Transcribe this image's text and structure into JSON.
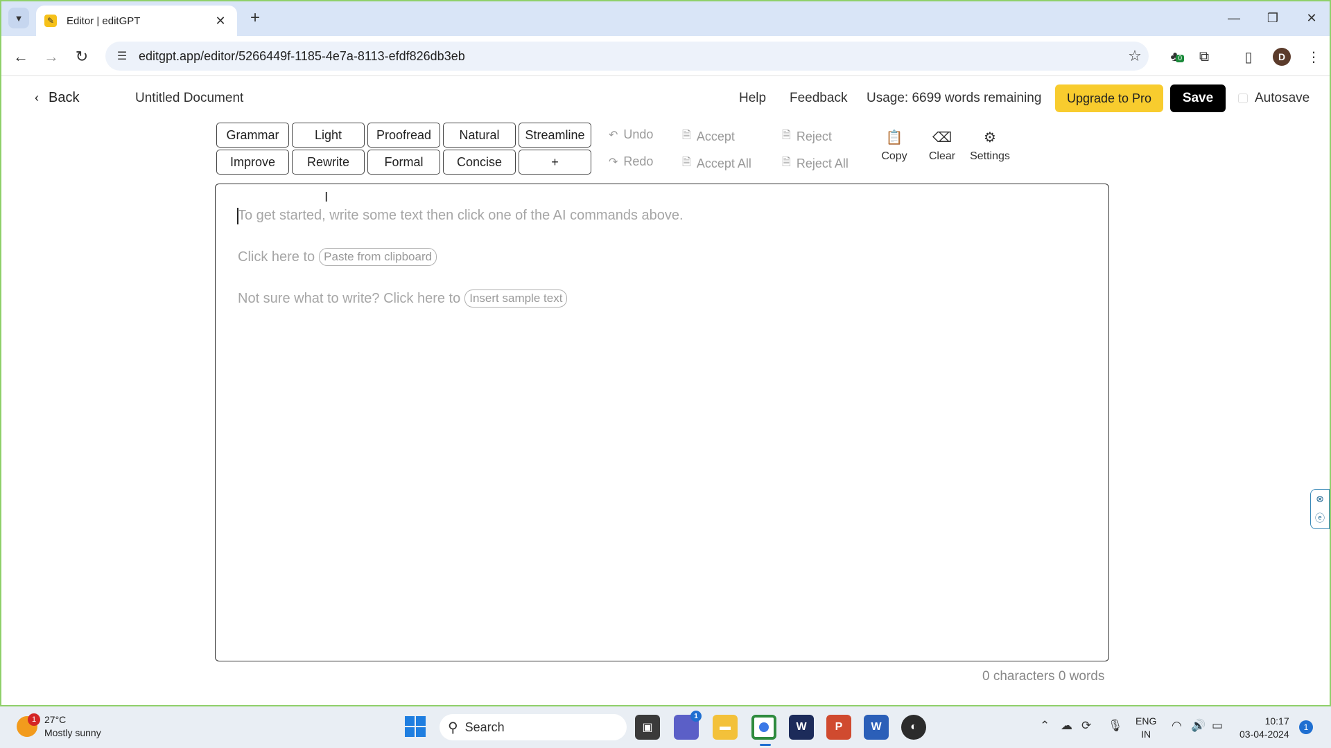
{
  "browser": {
    "tab_title": "Editor | editGPT",
    "url": "editgpt.app/editor/5266449f-1185-4e7a-8113-efdf826db3eb",
    "profile_initial": "D",
    "extension_badge": "0"
  },
  "header": {
    "back_label": "Back",
    "doc_title": "Untitled Document",
    "help_label": "Help",
    "feedback_label": "Feedback",
    "usage_text": "Usage: 6699 words remaining",
    "upgrade_label": "Upgrade to Pro",
    "save_label": "Save",
    "autosave_label": "Autosave"
  },
  "commands": {
    "row1": [
      "Grammar",
      "Light",
      "Proofread",
      "Natural",
      "Streamline"
    ],
    "row2": [
      "Improve",
      "Rewrite",
      "Formal",
      "Concise",
      "+"
    ]
  },
  "history": {
    "undo_label": "Undo",
    "redo_label": "Redo",
    "accept_label": "Accept",
    "accept_all_label": "Accept All",
    "reject_label": "Reject",
    "reject_all_label": "Reject All"
  },
  "tools": {
    "copy_label": "Copy",
    "clear_label": "Clear",
    "settings_label": "Settings"
  },
  "editor": {
    "placeholder": "To get started, write some text then click one of the AI commands above.",
    "paste_prefix": "Click here to",
    "paste_button": "Paste from clipboard",
    "sample_prefix": "Not sure what to write? Click here to",
    "sample_button": "Insert sample text",
    "counter": "0 characters  0 words"
  },
  "taskbar": {
    "weather_temp": "27°C",
    "weather_desc": "Mostly sunny",
    "weather_badge": "1",
    "search_label": "Search",
    "lang_line1": "ENG",
    "lang_line2": "IN",
    "time": "10:17",
    "date": "03-04-2024",
    "notification_count": "1",
    "teams_badge": "1"
  },
  "colors": {
    "upgrade_bg": "#f8cc2e",
    "save_bg": "#000000",
    "desktop_border": "#8fd06a"
  }
}
